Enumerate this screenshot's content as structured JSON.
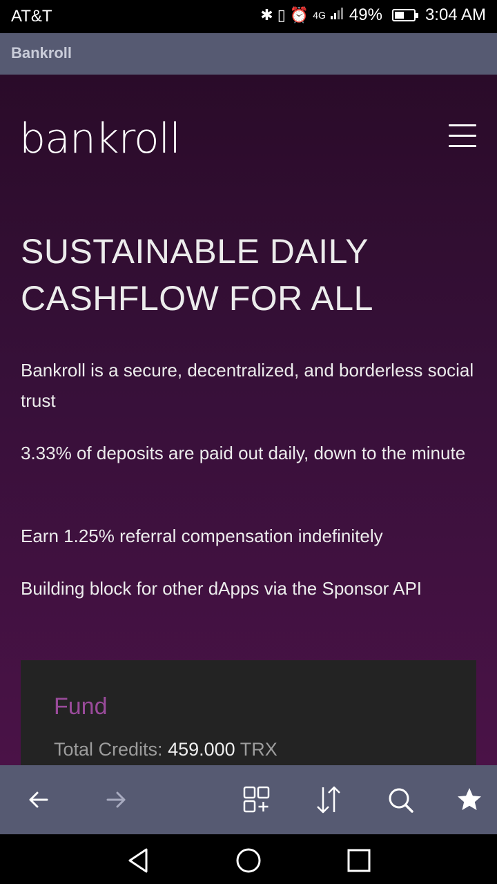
{
  "status_bar": {
    "carrier": "AT&T",
    "battery_percent": "49%",
    "time": "3:04 AM",
    "battery_level": 0.49,
    "network": "4G"
  },
  "browser": {
    "title": "Bankroll"
  },
  "site": {
    "logo": "bankroll",
    "hero": {
      "line1": "SUSTAINABLE DAILY",
      "line2": "CASHFLOW FOR ALL"
    },
    "features": [
      "Bankroll is a secure, decentralized, and borderless social trust",
      "3.33% of deposits are paid out daily, down to the minute",
      "Earn 1.25% referral compensation indefinitely",
      "Building block for other dApps via the Sponsor API"
    ],
    "fund": {
      "title": "Fund",
      "credits_label": "Total Credits:",
      "credits_value": "459.000",
      "credits_unit": "TRX"
    }
  },
  "icons": {
    "menu": "hamburger-menu-icon",
    "back": "arrow-left-icon",
    "forward": "arrow-right-icon",
    "tabs": "tabs-grid-icon",
    "scroll": "up-down-arrows-icon",
    "search": "search-icon",
    "bookmark": "star-icon"
  },
  "colors": {
    "page_top": "#2a0b29",
    "page_bottom": "#4a1247",
    "fund_title": "#9a4b9b",
    "toolbar": "#565a72"
  }
}
